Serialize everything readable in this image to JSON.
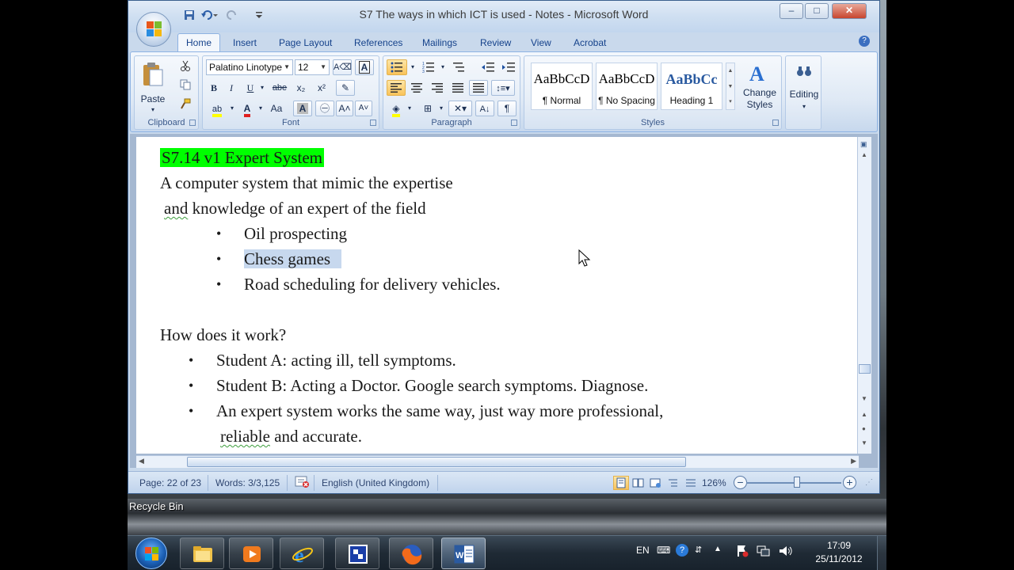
{
  "window": {
    "title": "S7  The ways in which ICT is used - Notes - Microsoft Word",
    "minimize": "–",
    "maximize": "□",
    "close": "✕"
  },
  "tabs": [
    "Home",
    "Insert",
    "Page Layout",
    "References",
    "Mailings",
    "Review",
    "View",
    "Acrobat"
  ],
  "ribbon": {
    "clipboard": {
      "label": "Clipboard",
      "paste": "Paste"
    },
    "font": {
      "label": "Font",
      "family": "Palatino Linotype",
      "size": "12",
      "bold": "B",
      "italic": "I",
      "underline": "U",
      "strike": "abe",
      "subscript": "x₂",
      "superscript": "x²",
      "case": "Aa",
      "grow": "A˄",
      "shrink": "A˅",
      "font_color_glyph": "A",
      "highlight_glyph": "ab"
    },
    "paragraph": {
      "label": "Paragraph",
      "pilcrow": "¶"
    },
    "styles": {
      "label": "Styles",
      "items": [
        {
          "sample": "AaBbCcD",
          "name": "¶ Normal"
        },
        {
          "sample": "AaBbCcD",
          "name": "¶ No Spacing"
        },
        {
          "sample": "AaBbCc",
          "name": "Heading 1"
        }
      ],
      "change_styles": "Change Styles"
    },
    "editing": {
      "label": "Editing"
    }
  },
  "document": {
    "heading": "S7.14 v1 Expert System",
    "line1": "A computer system that mimic the expertise",
    "line2_word": "and",
    "line2_rest": " knowledge of an expert of the field",
    "examples": [
      "Oil prospecting",
      "Chess games",
      "Road scheduling for delivery vehicles."
    ],
    "question": "How does it work?",
    "steps": [
      "Student A: acting ill, tell symptoms.",
      "Student B: Acting a Doctor. Google search symptoms. Diagnose.",
      "An expert system works the same way, just way more professional,"
    ],
    "steps_cont_word": "reliable",
    "steps_cont_rest": " and accurate.",
    "bullet": "•"
  },
  "statusbar": {
    "page": "Page: 22 of 23",
    "words": "Words: 3/3,125",
    "language": "English (United Kingdom)",
    "zoom": "126%",
    "zoom_minus": "−",
    "zoom_plus": "+"
  },
  "desktop": {
    "recycle_bin": "Recycle Bin"
  },
  "taskbar": {
    "lang": "EN",
    "time": "17:09",
    "date": "25/11/2012"
  },
  "colors": {
    "heading_highlight": "#00ff00",
    "selection": "#c7d8ee",
    "ribbon_active": "#f9c35a"
  }
}
